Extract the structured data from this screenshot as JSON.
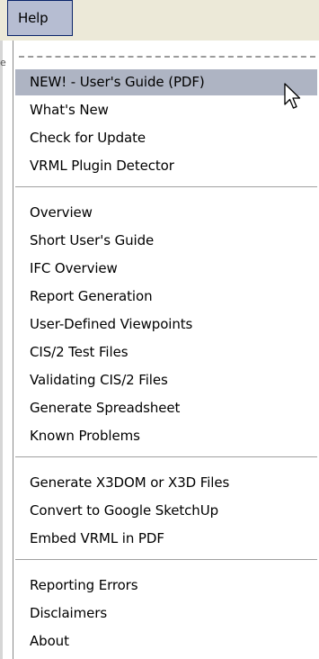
{
  "menubar": {
    "help_label": "Help"
  },
  "menu": {
    "items": [
      "NEW! - User's Guide (PDF)",
      "What's New",
      "Check for Update",
      "VRML Plugin Detector",
      "Overview",
      "Short User's Guide",
      "IFC Overview",
      "Report Generation",
      "User-Defined Viewpoints",
      "CIS/2 Test Files",
      "Validating CIS/2 Files",
      "Generate Spreadsheet",
      "Known Problems",
      "Generate X3DOM or X3D Files",
      "Convert to Google SketchUp",
      "Embed VRML in PDF",
      "Reporting Errors",
      "Disclaimers",
      "About"
    ],
    "highlighted_index": 0
  },
  "edge_glyph": "e",
  "icons": {
    "cursor": "arrow-cursor-icon"
  },
  "colors": {
    "menubar_bg": "#ece9d8",
    "selected_menu_bg": "#b6bdd2",
    "highlight_bg": "#aeb4c3"
  }
}
